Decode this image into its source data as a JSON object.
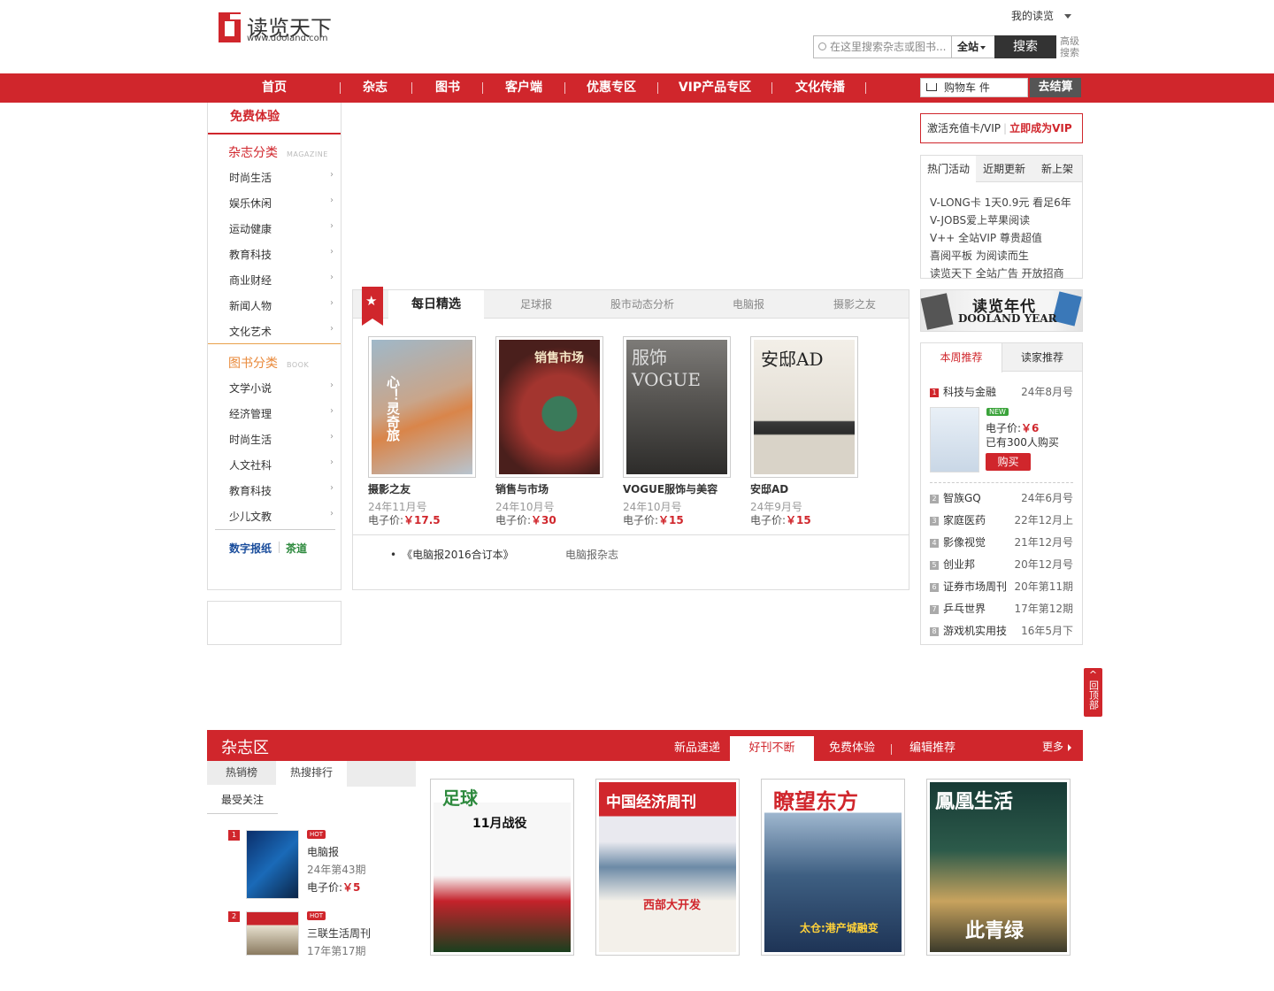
{
  "header": {
    "logo_cn": "读览天下",
    "logo_url": "www.dooland.com",
    "my_reading": "我的读览",
    "search_placeholder": "在这里搜索杂志或图书...",
    "search_scope": "全站",
    "search_button": "搜索",
    "advanced": "高级搜索"
  },
  "nav": {
    "items": [
      "首页",
      "杂志",
      "图书",
      "客户端",
      "优惠专区",
      "VIP产品专区",
      "文化传播"
    ],
    "cart": "购物车",
    "cart_unit": "件",
    "checkout": "去结算"
  },
  "left": {
    "free": "免费体验",
    "mag_head": "杂志分类",
    "mag_head_en": "MAGAZINE",
    "mag_items": [
      "时尚生活",
      "娱乐休闲",
      "运动健康",
      "教育科技",
      "商业财经",
      "新闻人物",
      "文化艺术"
    ],
    "book_head": "图书分类",
    "book_head_en": "BOOK",
    "book_items": [
      "文学小说",
      "经济管理",
      "时尚生活",
      "人文社科",
      "教育科技",
      "少儿文教"
    ],
    "digital": "数字报纸",
    "tea": "茶道"
  },
  "daily": {
    "tabs": [
      "每日精选",
      "足球报",
      "股市动态分析",
      "电脑报",
      "摄影之友"
    ],
    "mags": [
      {
        "name": "摄影之友",
        "issue": "24年11月号",
        "price_label": "电子价:",
        "price": "￥17.5"
      },
      {
        "name": "销售与市场",
        "issue": "24年10月号",
        "price_label": "电子价:",
        "price": "￥30"
      },
      {
        "name": "VOGUE服饰与美容",
        "issue": "24年10月号",
        "price_label": "电子价:",
        "price": "￥15"
      },
      {
        "name": "安邸AD",
        "issue": "24年9月号",
        "price_label": "电子价:",
        "price": "￥15"
      }
    ],
    "link1": "《电脑报2016合订本》",
    "link2": "电脑报杂志",
    "cover_text": [
      "心！灵奇旅",
      "销售市场",
      "服饰VOGUE",
      "安邸AD"
    ]
  },
  "right": {
    "vip_activate": "激活充值卡/VIP",
    "vip_join": "立即成为VIP",
    "tabs": [
      "热门活动",
      "近期更新",
      "新上架"
    ],
    "activities": [
      "V-LONG卡 1天0.9元 看足6年",
      "V-JOBS爱上苹果阅读",
      "V++ 全站VIP 尊贵超值",
      "喜阅平板 为阅读而生",
      "读览天下 全站广告 开放招商"
    ],
    "banner_cn": "读览年代",
    "banner_en": "DOOLAND YEAR",
    "week_tabs": [
      "本周推荐",
      "读家推荐"
    ],
    "rank": [
      {
        "n": "1",
        "name": "科技与金融",
        "date": "24年8月号"
      },
      {
        "n": "2",
        "name": "智族GQ",
        "date": "24年6月号"
      },
      {
        "n": "3",
        "name": "家庭医药",
        "date": "22年12月上"
      },
      {
        "n": "4",
        "name": "影像视觉",
        "date": "21年12月号"
      },
      {
        "n": "5",
        "name": "创业邦",
        "date": "20年12月号"
      },
      {
        "n": "6",
        "name": "证券市场周刊",
        "date": "20年第11期"
      },
      {
        "n": "7",
        "name": "乒乓世界",
        "date": "17年第12期"
      },
      {
        "n": "8",
        "name": "游戏机实用技",
        "date": "16年5月下"
      }
    ],
    "top_new": "NEW",
    "top_price_label": "电子价:",
    "top_price": "￥6",
    "top_bought": "已有300人购买",
    "top_buy": "购买"
  },
  "backtop": "回顶部",
  "zone": {
    "title": "杂志区",
    "tabs": [
      "新品速递",
      "好刊不断",
      "免费体验",
      "编辑推荐"
    ],
    "more": "更多",
    "left_tabs": [
      "热销榜",
      "热搜排行"
    ],
    "left_sub": "最受关注",
    "items": [
      {
        "n": "1",
        "hot": "HOT",
        "name": "电脑报",
        "issue": "24年第43期",
        "price_label": "电子价:",
        "price": "￥5"
      },
      {
        "n": "2",
        "hot": "HOT",
        "name": "三联生活周刊",
        "issue": "17年第17期"
      }
    ],
    "covers": [
      "足球",
      "中国经济周刊",
      "瞭望东方",
      "鳳凰生活"
    ],
    "cover_heads": [
      "11月战役",
      "西部大开发",
      "太仓:港产城融变",
      "此青绿"
    ]
  },
  "colors": {
    "brand": "#d0262c"
  }
}
